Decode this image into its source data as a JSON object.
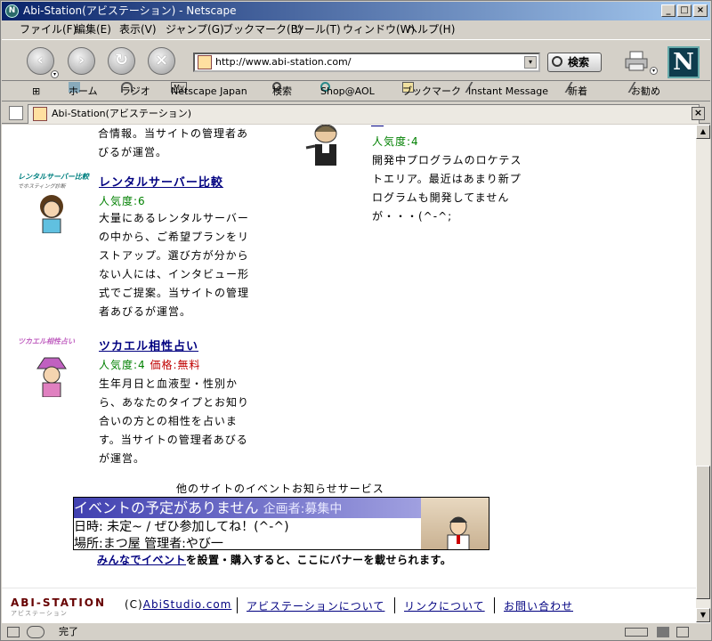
{
  "window": {
    "title": "Abi-Station(アビステーション) - Netscape"
  },
  "menu": [
    "ファイル(F)",
    "編集(E)",
    "表示(V)",
    "ジャンプ(G)",
    "ブックマーク(B)",
    "ツール(T)",
    "ウィンドウ(W)",
    "ヘルプ(H)"
  ],
  "navbar": {
    "url": "http://www.abi-station.com/",
    "search_label": "検索"
  },
  "personal_toolbar": {
    "items": [
      "ホーム",
      "ラジオ",
      "Netscape Japan",
      "検索",
      "Shop@AOL",
      "ブックマーク",
      "Instant Message",
      "新着",
      "お勧め"
    ],
    "my_badge": "My"
  },
  "tab": {
    "label": "Abi-Station(アビステーション)"
  },
  "content": {
    "left_top_lines": [
      "合情報。当サイトの管理者あ",
      "びるが運営。"
    ],
    "item1": {
      "logo": "レンタルサーバー比較",
      "logo_sub": "でホスティング診断",
      "title": "レンタルサーバー比較",
      "popularity": "人気度:6",
      "lines": [
        "大量にあるレンタルサーバー",
        "の中から、ご希望プランをリ",
        "ストアップ。選び方が分から",
        "ない人には、インタビュー形",
        "式でご提案。当サイトの管理",
        "者あびるが運営。"
      ]
    },
    "item2": {
      "logo": "ツカエル相性占い",
      "title": "ツカエル相性占い",
      "popularity": "人気度:4",
      "price": "価格:無料",
      "lines": [
        "生年月日と血液型・性別か",
        "ら、あなたのタイプとお知り",
        "合いの方との相性を占いま",
        "す。当サイトの管理者あびる",
        "が運営。"
      ]
    },
    "right_item": {
      "popularity": "人気度:4",
      "lines": [
        "開発中プログラムのロケテス",
        "トエリア。最近はあまり新プ",
        "ログラムも開発してません",
        "が・・・(^-^;"
      ]
    },
    "event": {
      "heading": "他のサイトのイベントお知らせサービス",
      "banner_title": "イベントの予定がありません",
      "banner_organizer": "企画者:募集中",
      "banner_date": "日時: 未定~ / ぜひ参加してね！(^-^)",
      "banner_place": "場所:まつ屋 管理者:やび一",
      "link_text": "みんなでイベント",
      "link_rest": "を設置・購入すると、ここにバナーを載せられます。"
    },
    "footer": {
      "logo": "ABI-STATION",
      "logo_sub": "アビステーション",
      "copyright_prefix": "(C)",
      "copyright_link": "AbiStudio.com",
      "links": [
        "アビステーションについて",
        "リンクについて",
        "お問い合わせ"
      ]
    }
  },
  "status": {
    "text": "完了"
  },
  "colors": {
    "link": "#000080",
    "popularity": "#008000",
    "price": "#c00000",
    "banner_bg": "#4040b0"
  }
}
